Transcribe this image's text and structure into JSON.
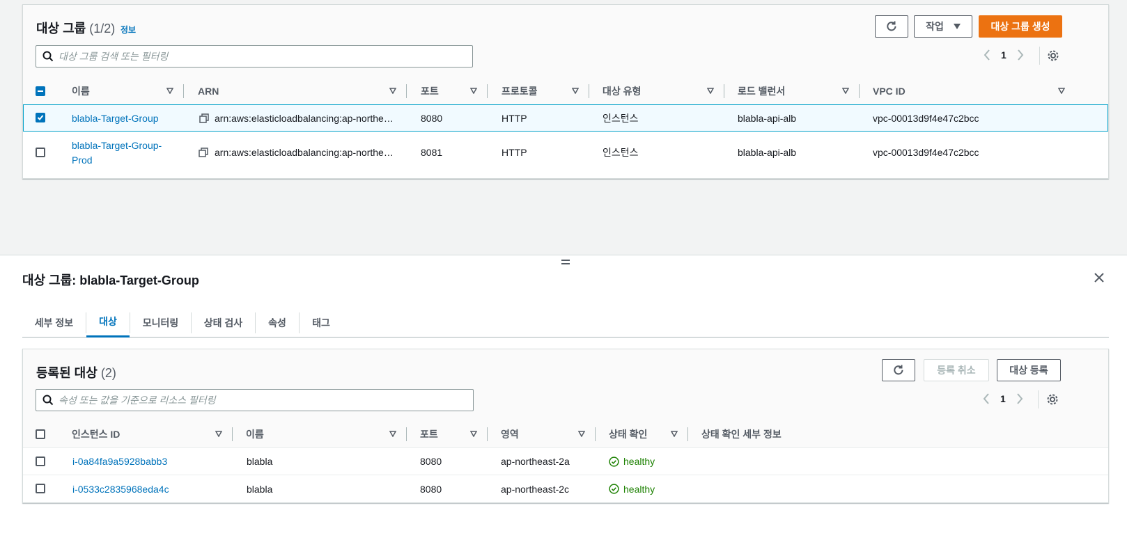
{
  "target_groups": {
    "title": "대상 그룹",
    "count": "(1/2)",
    "info_link": "정보",
    "actions_label": "작업",
    "create_label": "대상 그룹 생성",
    "search_placeholder": "대상 그룹 검색 또는 필터링",
    "page": "1",
    "columns": [
      "이름",
      "ARN",
      "포트",
      "프로토콜",
      "대상 유형",
      "로드 밸런서",
      "VPC ID"
    ],
    "rows": [
      {
        "name": "blabla-Target-Group",
        "arn": "arn:aws:elasticloadbalancing:ap-northe…",
        "port": "8080",
        "protocol": "HTTP",
        "target_type": "인스턴스",
        "load_balancer": "blabla-api-alb",
        "vpc_id": "vpc-00013d9f4e47c2bcc",
        "selected": true
      },
      {
        "name": "blabla-Target-Group-",
        "name_line2": "Prod",
        "arn": "arn:aws:elasticloadbalancing:ap-northe…",
        "port": "8081",
        "protocol": "HTTP",
        "target_type": "인스턴스",
        "load_balancer": "blabla-api-alb",
        "vpc_id": "vpc-00013d9f4e47c2bcc",
        "selected": false
      }
    ]
  },
  "detail": {
    "title": "대상 그룹: blabla-Target-Group",
    "tabs": [
      "세부 정보",
      "대상",
      "모니터링",
      "상태 검사",
      "속성",
      "태그"
    ],
    "active_tab": "대상"
  },
  "registered": {
    "title": "등록된 대상",
    "count": "(2)",
    "deregister_label": "등록 취소",
    "register_label": "대상 등록",
    "search_placeholder": "속성 또는 값을 기준으로 리소스 필터링",
    "page": "1",
    "columns": [
      "인스턴스 ID",
      "이름",
      "포트",
      "영역",
      "상태 확인",
      "상태 확인 세부 정보"
    ],
    "rows": [
      {
        "instance_id": "i-0a84fa9a5928babb3",
        "name": "blabla",
        "port": "8080",
        "zone": "ap-northeast-2a",
        "health": "healthy",
        "details": ""
      },
      {
        "instance_id": "i-0533c2835968eda4c",
        "name": "blabla",
        "port": "8080",
        "zone": "ap-northeast-2c",
        "health": "healthy",
        "details": ""
      }
    ]
  },
  "colors": {
    "primary": "#ec7211",
    "link": "#0073bb",
    "healthy": "#1d8102",
    "selected_bg": "#f1faff"
  },
  "icons": [
    "refresh-icon",
    "caret-down-icon",
    "search-icon",
    "chevron-left-icon",
    "chevron-right-icon",
    "gear-icon",
    "copy-icon",
    "close-icon",
    "check-circle-icon",
    "drag-handle-icon"
  ]
}
